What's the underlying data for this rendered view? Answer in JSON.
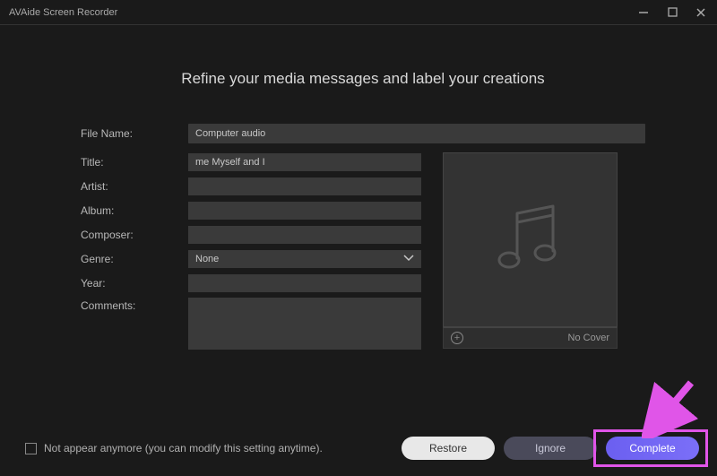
{
  "window": {
    "title": "AVAide Screen Recorder"
  },
  "heading": "Refine your media messages and label your creations",
  "form": {
    "labels": {
      "filename": "File Name:",
      "title": "Title:",
      "artist": "Artist:",
      "album": "Album:",
      "composer": "Composer:",
      "genre": "Genre:",
      "year": "Year:",
      "comments": "Comments:"
    },
    "values": {
      "filename": "Computer audio",
      "title": "me Myself and I",
      "artist": "",
      "album": "",
      "composer": "",
      "genre": "None",
      "year": "",
      "comments": ""
    }
  },
  "cover": {
    "no_cover": "No Cover"
  },
  "footer": {
    "checkbox_label": "Not appear anymore (you can modify this setting anytime).",
    "restore": "Restore",
    "ignore": "Ignore",
    "complete": "Complete"
  }
}
